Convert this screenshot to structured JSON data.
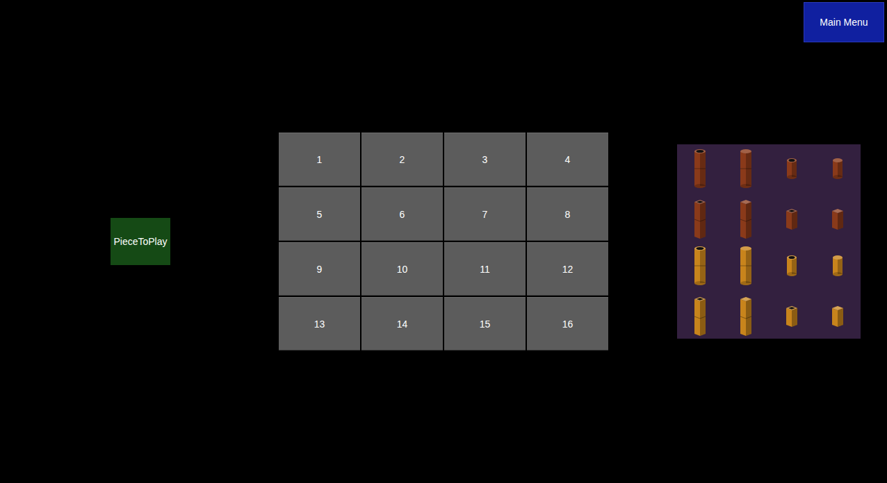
{
  "menu_button": "Main Menu",
  "piece_to_play": {
    "label": "PieceToPlay"
  },
  "board": {
    "cells": [
      "1",
      "2",
      "3",
      "4",
      "5",
      "6",
      "7",
      "8",
      "9",
      "10",
      "11",
      "12",
      "13",
      "14",
      "15",
      "16"
    ]
  },
  "pieces": [
    {
      "kind": "round",
      "tall": true,
      "hollow": true,
      "color": "#8a3a1a"
    },
    {
      "kind": "round",
      "tall": true,
      "hollow": false,
      "color": "#8a3a1a"
    },
    {
      "kind": "round",
      "tall": false,
      "hollow": true,
      "color": "#8a3a1a"
    },
    {
      "kind": "round",
      "tall": false,
      "hollow": false,
      "color": "#8a3a1a"
    },
    {
      "kind": "square",
      "tall": true,
      "hollow": true,
      "color": "#8a3a1a"
    },
    {
      "kind": "square",
      "tall": true,
      "hollow": false,
      "color": "#8a3a1a"
    },
    {
      "kind": "square",
      "tall": false,
      "hollow": true,
      "color": "#8a3a1a"
    },
    {
      "kind": "square",
      "tall": false,
      "hollow": false,
      "color": "#8a3a1a"
    },
    {
      "kind": "round",
      "tall": true,
      "hollow": true,
      "color": "#c8841c"
    },
    {
      "kind": "round",
      "tall": true,
      "hollow": false,
      "color": "#c8841c"
    },
    {
      "kind": "round",
      "tall": false,
      "hollow": true,
      "color": "#c8841c"
    },
    {
      "kind": "round",
      "tall": false,
      "hollow": false,
      "color": "#c8841c"
    },
    {
      "kind": "square",
      "tall": true,
      "hollow": true,
      "color": "#c8841c"
    },
    {
      "kind": "square",
      "tall": true,
      "hollow": false,
      "color": "#c8841c"
    },
    {
      "kind": "square",
      "tall": false,
      "hollow": true,
      "color": "#c8841c"
    },
    {
      "kind": "square",
      "tall": false,
      "hollow": false,
      "color": "#c8841c"
    }
  ]
}
